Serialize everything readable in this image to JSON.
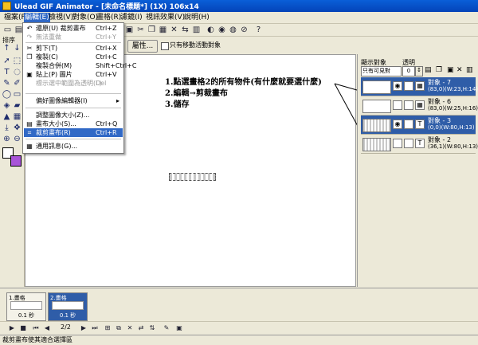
{
  "window": {
    "title": "Ulead GIF Animator - [未命名標題*] (1X) 106x14"
  },
  "menubar": [
    {
      "label": "檔案(F)"
    },
    {
      "label": "編輯(E)"
    },
    {
      "label": "檢視(V)"
    },
    {
      "label": "對象(O)"
    },
    {
      "label": "畫格(R)"
    },
    {
      "label": "濾鏡(I)"
    },
    {
      "label": "視訊效果(V)"
    },
    {
      "label": "說明(H)"
    }
  ],
  "edit_menu": {
    "items": [
      {
        "icon": "undo-icon",
        "label": "還原(U) 裁剪畫布",
        "shortcut": "Ctrl+Z",
        "state": "normal"
      },
      {
        "icon": "redo-icon",
        "label": "無法重做",
        "shortcut": "Ctrl+Y",
        "state": "disabled"
      },
      {
        "icon": "cut-icon",
        "label": "剪下(T)",
        "shortcut": "Ctrl+X",
        "state": "normal"
      },
      {
        "icon": "copy-icon",
        "label": "複製(C)",
        "shortcut": "Ctrl+C",
        "state": "normal"
      },
      {
        "icon": "",
        "label": "複製合併(M)",
        "shortcut": "Shift+Ctrl+C",
        "state": "normal"
      },
      {
        "icon": "paste-icon",
        "label": "貼上(P) 圖片",
        "shortcut": "Ctrl+V",
        "state": "normal"
      },
      {
        "icon": "",
        "label": "標示選中範圍為透明(L)",
        "shortcut": "Del",
        "state": "disabled"
      },
      {
        "icon": "",
        "label": "偏好圖像編輯器(I)",
        "shortcut": "▸",
        "state": "normal"
      },
      {
        "icon": "",
        "label": "調整圖像大小(Z)...",
        "shortcut": "",
        "state": "normal"
      },
      {
        "icon": "canvas-icon",
        "label": "畫布大小(S)...",
        "shortcut": "Ctrl+Q",
        "state": "normal"
      },
      {
        "icon": "crop-icon",
        "label": "裁剪畫布(R)",
        "shortcut": "Ctrl+R",
        "state": "highlighted"
      },
      {
        "icon": "prefs-icon",
        "label": "通用訊息(G)...",
        "shortcut": "",
        "state": "normal"
      }
    ]
  },
  "attributes": {
    "properties_button": "屬性...",
    "only_moving_label": "只有移動活動對象"
  },
  "left_panel": {
    "sort_label": "排序"
  },
  "canvas": {
    "annotation": [
      "1.點選畫格2的所有物件(有什麼就要選什麼)",
      "2.編輯→剪裁畫布",
      "3.儲存"
    ]
  },
  "objects_panel": {
    "display_label": "顯示對象",
    "transparency_label": "透明",
    "display_select": "只有可見對",
    "transparency_value": "0",
    "objects": [
      {
        "name": "對象 - 7",
        "info": "(83,0)(W:23,H:14)",
        "selected": true,
        "thumb": "eye-icon"
      },
      {
        "name": "對象 - 6",
        "info": "(83,0)(W:25,H:16)",
        "selected": false,
        "thumb": "eye-icon"
      },
      {
        "name": "對象 - 3",
        "info": "(0,0)(W:80,H:13)",
        "selected": true,
        "thumb": "strip"
      },
      {
        "name": "對象 - 2",
        "info": "(36,1)(W:80,H:13)",
        "selected": false,
        "thumb": "strip"
      }
    ]
  },
  "frames": [
    {
      "label": "1.畫格",
      "delay": "0.1 秒",
      "selected": false
    },
    {
      "label": "2.畫格",
      "delay": "0.1 秒",
      "selected": true
    }
  ],
  "playbar": {
    "counter": "2/2"
  },
  "statusbar": {
    "text": "裁剪畫布使其適合選擇區"
  }
}
